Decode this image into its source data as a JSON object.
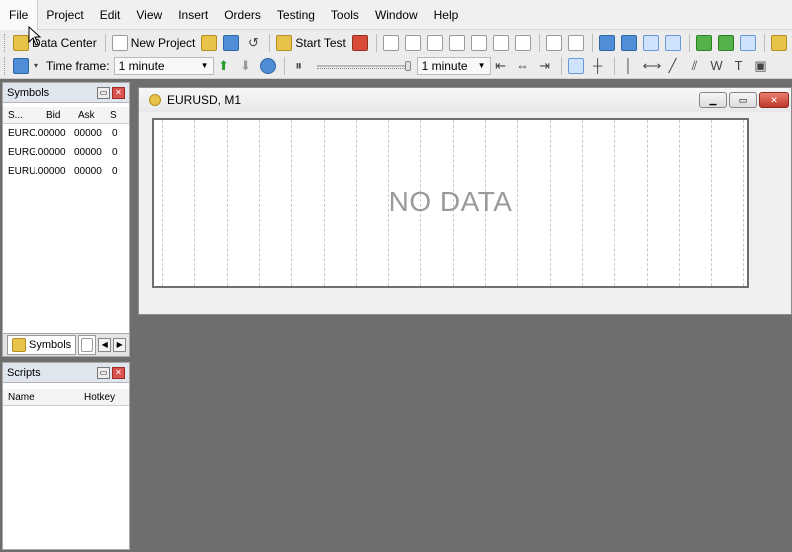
{
  "menu": [
    "File",
    "Project",
    "Edit",
    "View",
    "Insert",
    "Orders",
    "Testing",
    "Tools",
    "Window",
    "Help"
  ],
  "toolbar1": {
    "data_center": "Data Center",
    "new_project": "New Project",
    "start_test": "Start Test"
  },
  "toolbar2": {
    "timeframe_label": "Time frame:",
    "timeframe_value": "1 minute",
    "speed_value": "1 minute"
  },
  "symbols_panel": {
    "title": "Symbols",
    "columns": [
      "S...",
      "Bid",
      "Ask",
      "S"
    ],
    "rows": [
      {
        "symbol": "EURC",
        "bid": ".00000",
        "ask": "00000",
        "s": "0"
      },
      {
        "symbol": "EURG",
        "bid": ".00000",
        "ask": "00000",
        "s": "0"
      },
      {
        "symbol": "EURU",
        "bid": ".00000",
        "ask": "00000",
        "s": "0"
      }
    ],
    "tab_label": "Symbols"
  },
  "scripts_panel": {
    "title": "Scripts",
    "columns": [
      "Name",
      "Hotkey"
    ]
  },
  "chart_window": {
    "title": "EURUSD, M1",
    "message": "NO DATA"
  }
}
